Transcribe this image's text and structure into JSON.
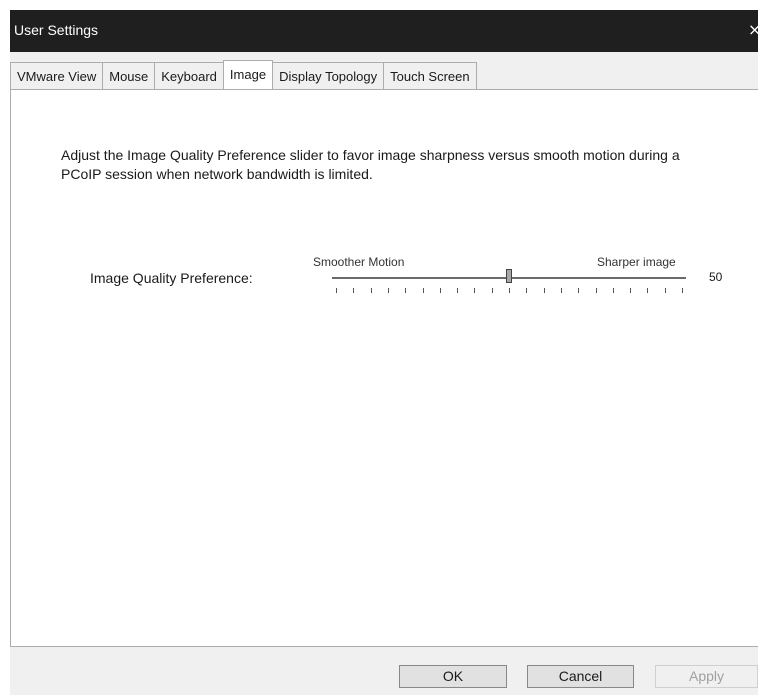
{
  "window": {
    "title": "User Settings",
    "close_glyph": "×"
  },
  "tabs": [
    {
      "label": "VMware View",
      "active": false
    },
    {
      "label": "Mouse",
      "active": false
    },
    {
      "label": "Keyboard",
      "active": false
    },
    {
      "label": "Image",
      "active": true
    },
    {
      "label": "Display Topology",
      "active": false
    },
    {
      "label": "Touch Screen",
      "active": false
    }
  ],
  "image_tab": {
    "description": "Adjust the Image Quality Preference slider to favor image sharpness versus smooth motion during a PCoIP session when network bandwidth is limited.",
    "preference_label": "Image Quality Preference:",
    "slider": {
      "left_label": "Smoother Motion",
      "right_label": "Sharper image",
      "value": "50",
      "min": 0,
      "max": 100,
      "tick_count": 21
    }
  },
  "buttons": {
    "ok": "OK",
    "cancel": "Cancel",
    "apply": "Apply"
  },
  "colors": {
    "titlebar": "#1f1f1f",
    "dialog_background": "#f0f0f0",
    "panel_background": "#ffffff"
  }
}
